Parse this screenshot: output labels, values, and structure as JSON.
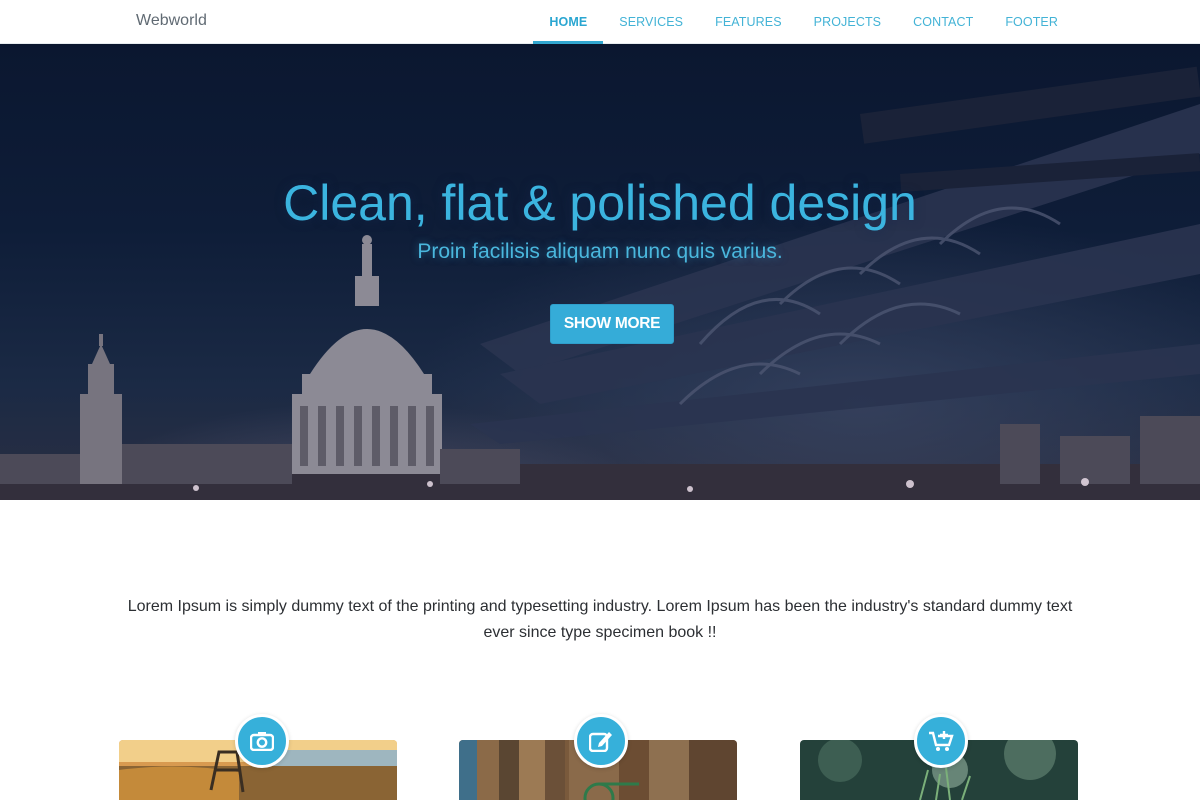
{
  "brand": "Webworld",
  "nav": [
    {
      "label": "HOME",
      "active": true
    },
    {
      "label": "SERVICES",
      "active": false
    },
    {
      "label": "FEATURES",
      "active": false
    },
    {
      "label": "PROJECTS",
      "active": false
    },
    {
      "label": "CONTACT",
      "active": false
    },
    {
      "label": "FOOTER",
      "active": false
    }
  ],
  "hero": {
    "title": "Clean, flat & polished design",
    "subtitle": "Proin facilisis aliquam nunc quis varius.",
    "button": "SHOW MORE"
  },
  "intro": {
    "text": "Lorem Ipsum is simply dummy text of the printing and typesetting industry. Lorem Ipsum has been the industry's standard dummy text ever since type specimen book !!"
  },
  "features": [
    {
      "icon": "camera-icon"
    },
    {
      "icon": "edit-icon"
    },
    {
      "icon": "cart-add-icon"
    }
  ],
  "colors": {
    "accent": "#36b0da",
    "nav_text": "#43b3d6",
    "hero_bg": "#0e1d38"
  }
}
